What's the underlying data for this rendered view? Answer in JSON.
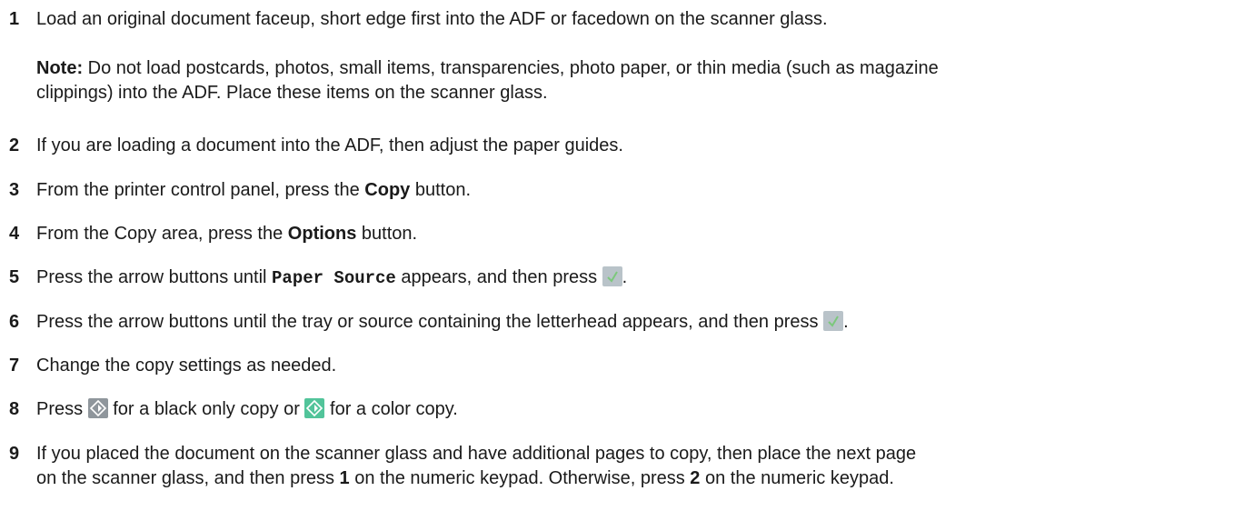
{
  "steps": [
    {
      "num": "1",
      "text": "Load an original document faceup, short edge first into the ADF or facedown on the scanner glass."
    },
    {
      "num": "2",
      "text": "If you are loading a document into the ADF, then adjust the paper guides."
    },
    {
      "num": "3",
      "pre": "From the printer control panel, press the ",
      "bold": "Copy",
      "post": " button."
    },
    {
      "num": "4",
      "pre": "From the Copy area, press the ",
      "bold": "Options",
      "post": " button."
    },
    {
      "num": "5",
      "pre": "Press the arrow buttons until ",
      "mono": "Paper Source",
      "post": " appears, and then press ",
      "end": "."
    },
    {
      "num": "6",
      "pre": "Press the arrow buttons until the tray or source containing the letterhead appears, and then press ",
      "end": "."
    },
    {
      "num": "7",
      "text": "Change the copy settings as needed."
    },
    {
      "num": "8",
      "pre": "Press ",
      "mid": " for a black only copy or ",
      "post": " for a color copy."
    },
    {
      "num": "9",
      "line1": "If you placed the document on the scanner glass and have additional pages to copy, then place the next page",
      "line2_pre": "on the scanner glass, and then press ",
      "key1": "1",
      "line2_mid": " on the numeric keypad. Otherwise, press ",
      "key2": "2",
      "line2_post": " on the numeric keypad."
    }
  ],
  "note": {
    "label": "Note:",
    "line1": " Do not load postcards, photos, small items, transparencies, photo paper, or thin media (such as magazine",
    "line2": "clippings) into the ADF. Place these items on the scanner glass."
  },
  "icons": {
    "select": "checkmark-select-icon",
    "start_black": "start-black-icon",
    "start_color": "start-color-icon"
  },
  "colors": {
    "select_bg": "#b9c3c9",
    "select_check": "#7cc87c",
    "start_black_bg": "#8f969c",
    "start_color_bg": "#52c49a"
  }
}
